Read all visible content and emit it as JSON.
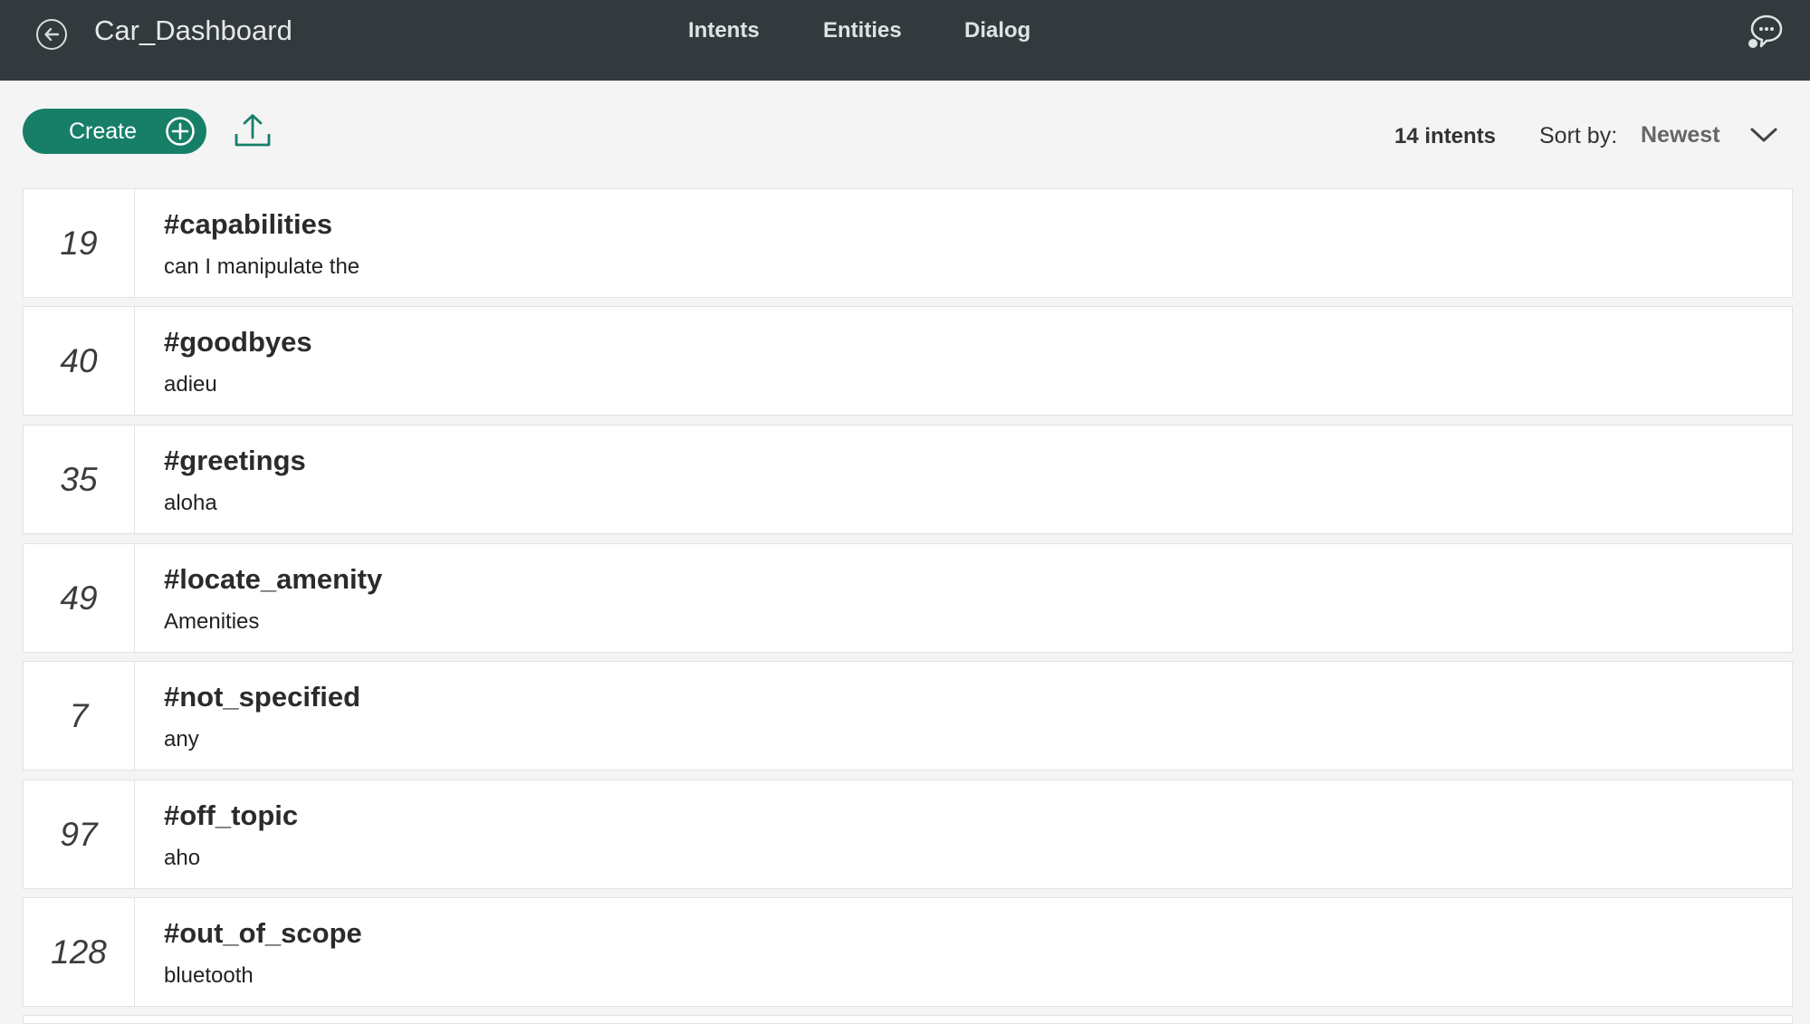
{
  "header": {
    "title": "Car_Dashboard",
    "tabs": [
      {
        "label": "Intents"
      },
      {
        "label": "Entities"
      },
      {
        "label": "Dialog"
      }
    ]
  },
  "toolbar": {
    "create_label": "Create",
    "count_label": "14 intents",
    "sort_label": "Sort by:",
    "sort_value": "Newest"
  },
  "intents": [
    {
      "count": "19",
      "name": "#capabilities",
      "example": "can I manipulate the"
    },
    {
      "count": "40",
      "name": "#goodbyes",
      "example": "adieu"
    },
    {
      "count": "35",
      "name": "#greetings",
      "example": "aloha"
    },
    {
      "count": "49",
      "name": "#locate_amenity",
      "example": "Amenities"
    },
    {
      "count": "7",
      "name": "#not_specified",
      "example": "any"
    },
    {
      "count": "97",
      "name": "#off_topic",
      "example": "aho"
    },
    {
      "count": "128",
      "name": "#out_of_scope",
      "example": "bluetooth"
    }
  ],
  "colors": {
    "header_bg": "#323a3e",
    "accent": "#177f68"
  },
  "icons": [
    "back-arrow-icon",
    "chat-bubble-icon",
    "plus-circle-icon",
    "upload-icon",
    "chevron-down-icon"
  ]
}
